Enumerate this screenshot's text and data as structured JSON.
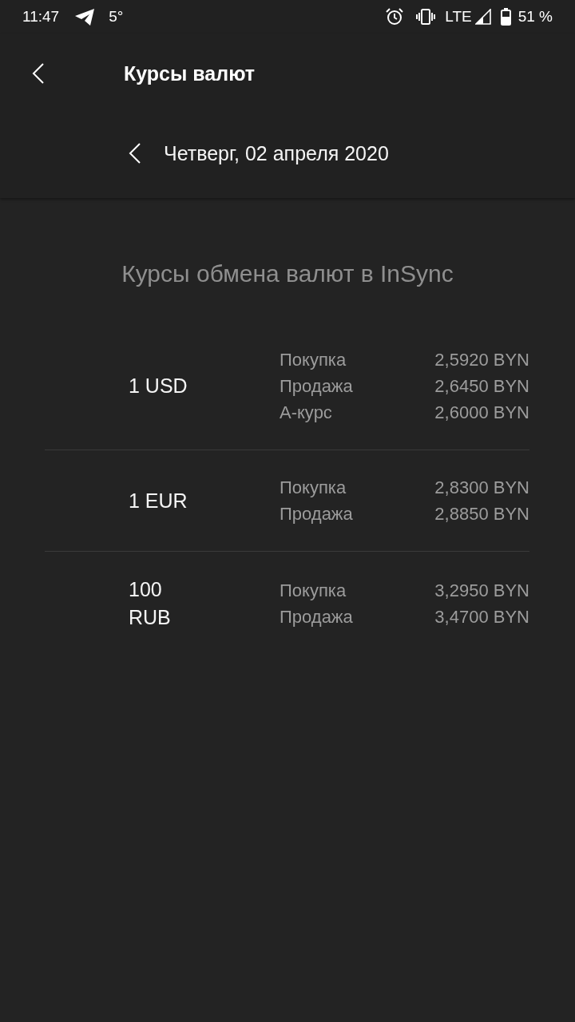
{
  "status_bar": {
    "time": "11:47",
    "temperature": "5°",
    "network": "LTE",
    "battery": "51 %"
  },
  "app_bar": {
    "title": "Курсы валют"
  },
  "date_nav": {
    "date": "Четверг, 02 апреля 2020"
  },
  "heading": "Курсы обмена валют в InSync",
  "rates": [
    {
      "currency": "1 USD",
      "quotes": [
        {
          "label": "Покупка",
          "value": "2,5920 BYN"
        },
        {
          "label": "Продажа",
          "value": "2,6450 BYN"
        },
        {
          "label": "А-курс",
          "value": "2,6000 BYN"
        }
      ]
    },
    {
      "currency": "1 EUR",
      "quotes": [
        {
          "label": "Покупка",
          "value": "2,8300 BYN"
        },
        {
          "label": "Продажа",
          "value": "2,8850 BYN"
        }
      ]
    },
    {
      "currency": "100 RUB",
      "quotes": [
        {
          "label": "Покупка",
          "value": "3,2950 BYN"
        },
        {
          "label": "Продажа",
          "value": "3,4700 BYN"
        }
      ]
    }
  ]
}
